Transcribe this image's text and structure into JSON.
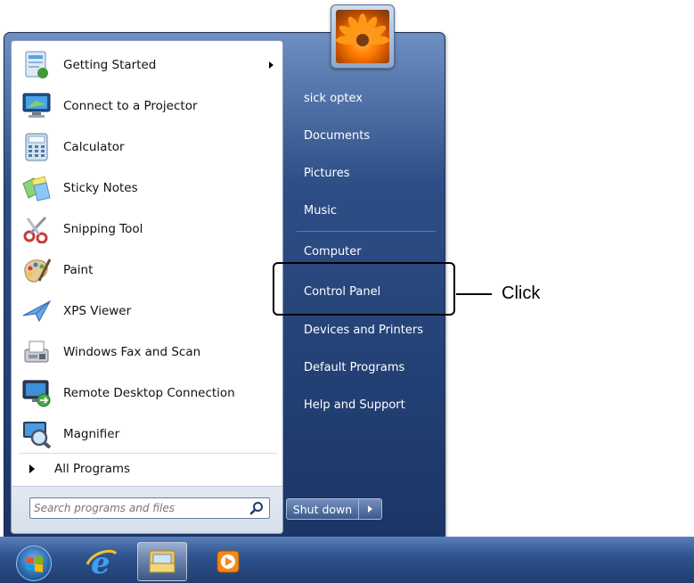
{
  "start_menu": {
    "programs": [
      {
        "label": "Getting Started",
        "icon": "getting-started-icon",
        "has_submenu": true
      },
      {
        "label": "Connect to a Projector",
        "icon": "projector-icon",
        "has_submenu": false
      },
      {
        "label": "Calculator",
        "icon": "calculator-icon",
        "has_submenu": false
      },
      {
        "label": "Sticky Notes",
        "icon": "sticky-notes-icon",
        "has_submenu": false
      },
      {
        "label": "Snipping Tool",
        "icon": "scissors-icon",
        "has_submenu": false
      },
      {
        "label": "Paint",
        "icon": "paint-palette-icon",
        "has_submenu": false
      },
      {
        "label": "XPS Viewer",
        "icon": "paper-plane-icon",
        "has_submenu": false
      },
      {
        "label": "Windows Fax and Scan",
        "icon": "fax-icon",
        "has_submenu": false
      },
      {
        "label": "Remote Desktop Connection",
        "icon": "remote-desktop-icon",
        "has_submenu": false
      },
      {
        "label": "Magnifier",
        "icon": "magnifier-icon",
        "has_submenu": false
      }
    ],
    "all_programs": "All Programs",
    "search": {
      "placeholder": "Search programs and files"
    },
    "right_items": [
      "sick optex",
      "Documents",
      "Pictures",
      "Music",
      "Computer",
      "Control Panel",
      "Devices and Printers",
      "Default Programs",
      "Help and Support"
    ],
    "shutdown_label": "Shut down"
  },
  "taskbar": {
    "items": [
      "start-orb-icon",
      "internet-explorer-icon",
      "file-explorer-icon",
      "media-player-icon"
    ]
  },
  "annotation": {
    "label": "Click"
  },
  "colors": {
    "menu_blue": "#2d4e86",
    "taskbar_blue": "#2f548f",
    "callout": "#000000"
  }
}
